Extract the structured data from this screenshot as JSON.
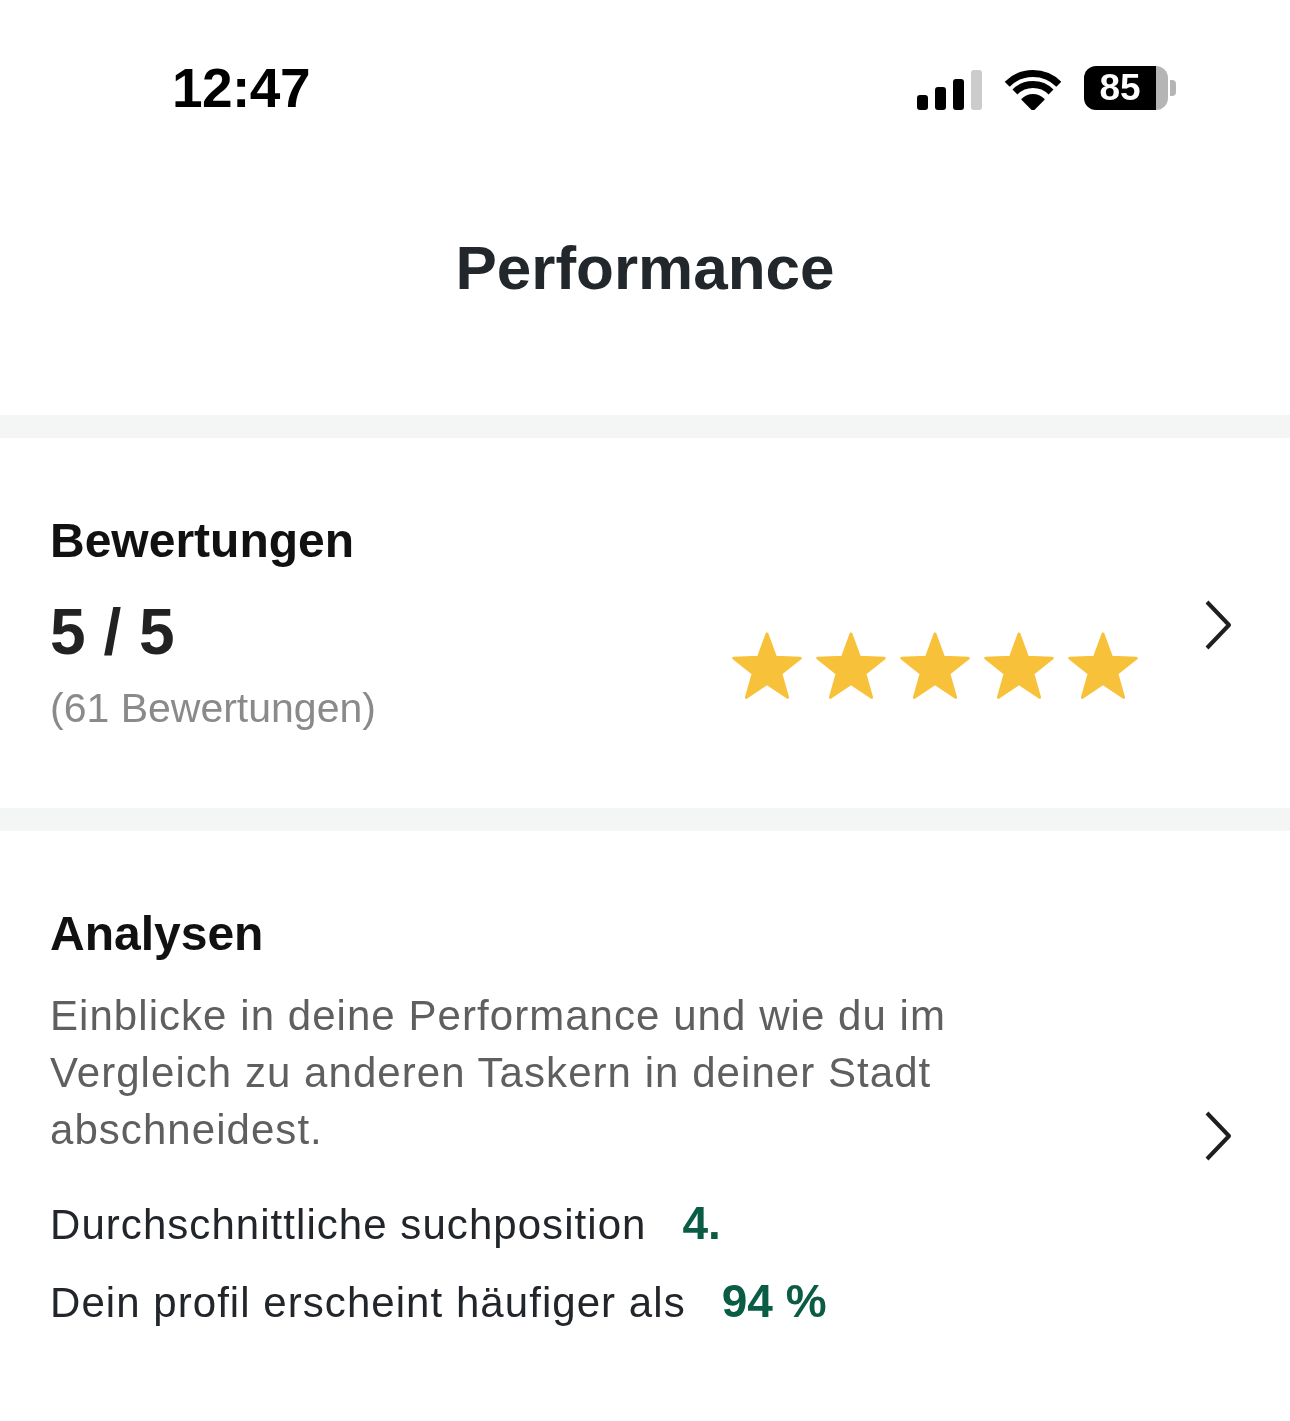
{
  "status_bar": {
    "time": "12:47",
    "battery": "85"
  },
  "header": {
    "title": "Performance"
  },
  "ratings": {
    "title": "Bewertungen",
    "score": "5 / 5",
    "count": "(61 Bewertungen)",
    "stars": 5
  },
  "analytics": {
    "title": "Analysen",
    "description": "Einblicke in deine Performance und wie du im Vergleich zu anderen Taskern in deiner Stadt abschneidest.",
    "stats": [
      {
        "label": "Durchschnittliche suchposition",
        "value": "4."
      },
      {
        "label": "Dein profil erscheint häufiger als",
        "value": "94 %"
      }
    ]
  }
}
